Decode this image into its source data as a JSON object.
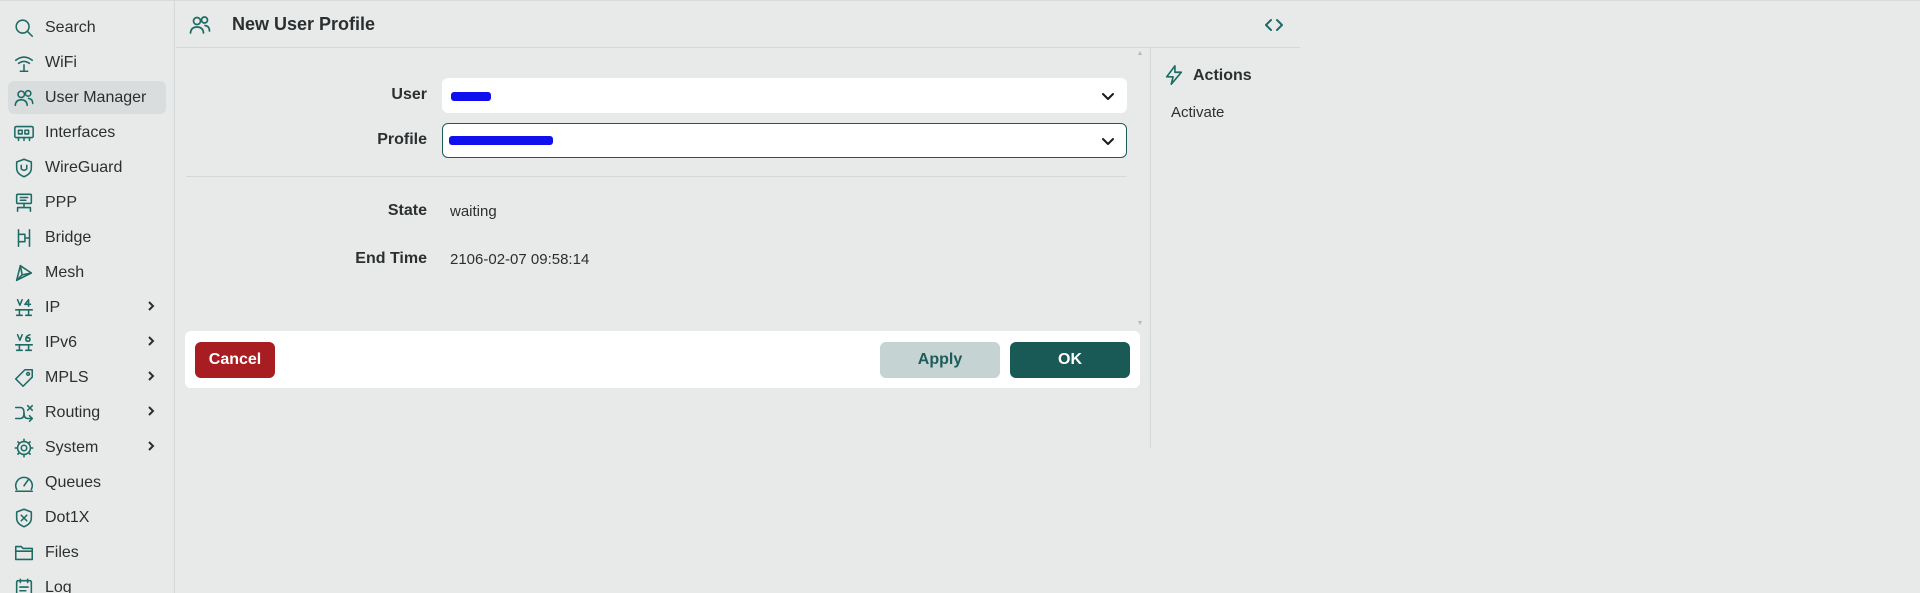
{
  "sidebar": {
    "items": [
      {
        "label": "Search",
        "icon": "search-icon",
        "has_submenu": false,
        "active": false
      },
      {
        "label": "WiFi",
        "icon": "wifi-icon",
        "has_submenu": false,
        "active": false
      },
      {
        "label": "User Manager",
        "icon": "users-icon",
        "has_submenu": false,
        "active": true
      },
      {
        "label": "Interfaces",
        "icon": "interfaces-icon",
        "has_submenu": false,
        "active": false
      },
      {
        "label": "WireGuard",
        "icon": "shield-icon",
        "has_submenu": false,
        "active": false
      },
      {
        "label": "PPP",
        "icon": "ppp-icon",
        "has_submenu": false,
        "active": false
      },
      {
        "label": "Bridge",
        "icon": "bridge-icon",
        "has_submenu": false,
        "active": false
      },
      {
        "label": "Mesh",
        "icon": "mesh-icon",
        "has_submenu": false,
        "active": false
      },
      {
        "label": "IP",
        "icon": "ipv4-icon",
        "has_submenu": true,
        "active": false
      },
      {
        "label": "IPv6",
        "icon": "ipv6-icon",
        "has_submenu": true,
        "active": false
      },
      {
        "label": "MPLS",
        "icon": "tag-icon",
        "has_submenu": true,
        "active": false
      },
      {
        "label": "Routing",
        "icon": "routing-icon",
        "has_submenu": true,
        "active": false
      },
      {
        "label": "System",
        "icon": "gear-icon",
        "has_submenu": true,
        "active": false
      },
      {
        "label": "Queues",
        "icon": "gauge-icon",
        "has_submenu": false,
        "active": false
      },
      {
        "label": "Dot1X",
        "icon": "dot1x-icon",
        "has_submenu": false,
        "active": false
      },
      {
        "label": "Files",
        "icon": "folder-icon",
        "has_submenu": false,
        "active": false
      },
      {
        "label": "Log",
        "icon": "log-icon",
        "has_submenu": false,
        "active": false
      }
    ]
  },
  "header": {
    "title": "New User Profile",
    "icon": "users-icon"
  },
  "form": {
    "user_label": "User",
    "profile_label": "Profile",
    "state_label": "State",
    "state_value": "waiting",
    "end_time_label": "End Time",
    "end_time_value": "2106-02-07 09:58:14"
  },
  "footer": {
    "cancel_label": "Cancel",
    "apply_label": "Apply",
    "ok_label": "OK"
  },
  "actions": {
    "title": "Actions",
    "items": [
      "Activate"
    ]
  },
  "colors": {
    "accent": "#1d6b64",
    "primary_button": "#1a5a56",
    "cancel_button": "#a81d22",
    "apply_button": "#c5d3d3",
    "background": "#e8eaea"
  }
}
